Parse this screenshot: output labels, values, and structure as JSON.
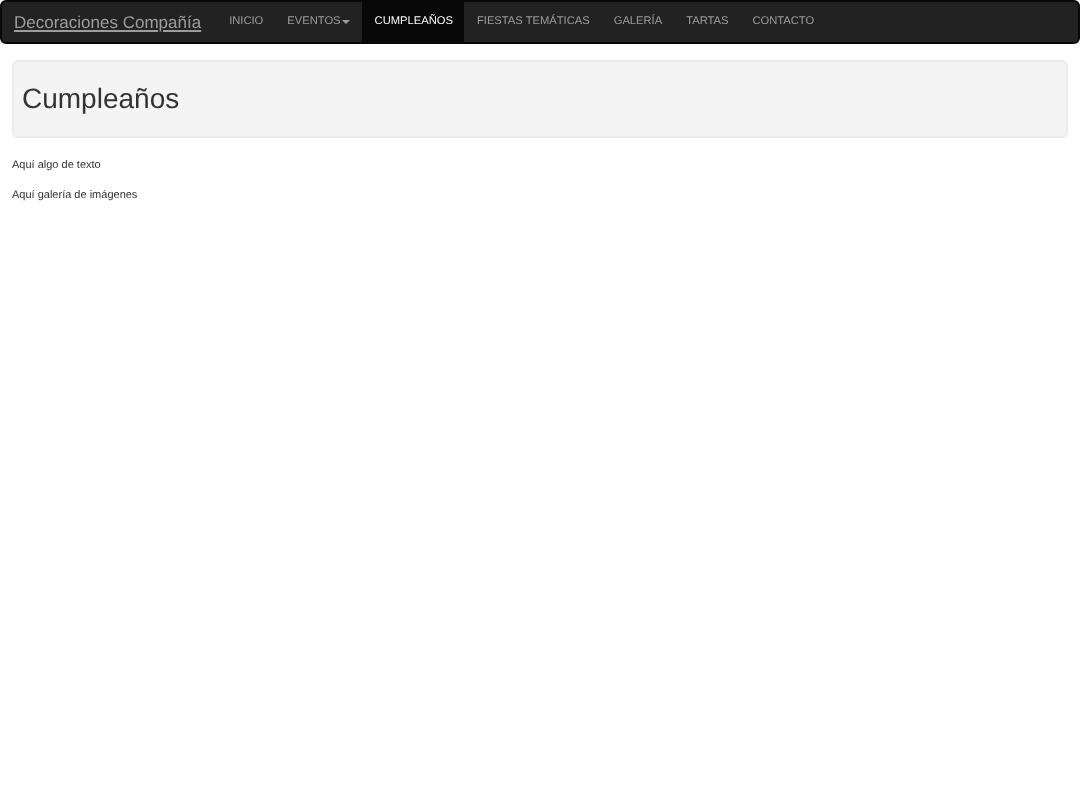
{
  "navbar": {
    "brand": "Decoraciones Compañía",
    "items": [
      {
        "label": "INICIO",
        "kind": "link",
        "selected": false
      },
      {
        "label": "EVENTOS",
        "kind": "dropdown",
        "selected": false
      },
      {
        "label": "CUMPLEAÑOS",
        "kind": "link",
        "selected": true
      },
      {
        "label": "FIESTAS TEMÁTICAS",
        "kind": "link",
        "selected": false
      },
      {
        "label": "GALERÍA",
        "kind": "link",
        "selected": false
      },
      {
        "label": "TARTAS",
        "kind": "link",
        "selected": false
      },
      {
        "label": "CONTACTO",
        "kind": "link",
        "selected": false
      }
    ]
  },
  "header": {
    "title": "Cumpleaños"
  },
  "paragraphs": [
    "Aquí algo de texto",
    "Aquí galería de imágenes"
  ]
}
